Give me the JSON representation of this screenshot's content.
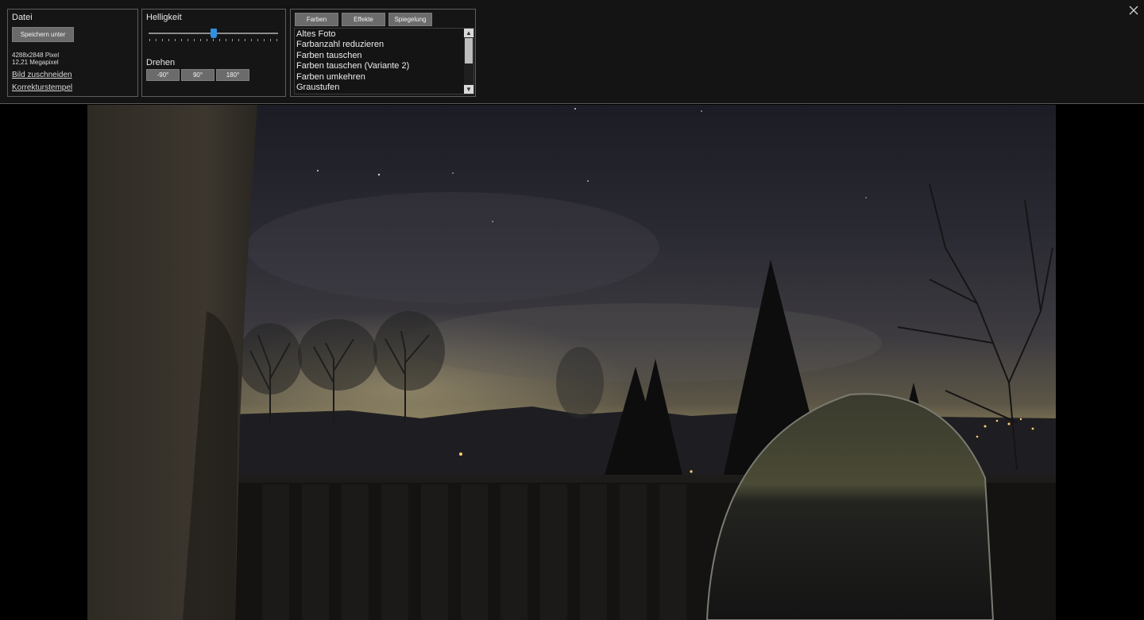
{
  "file_panel": {
    "title": "Datei",
    "save_as_label": "Speichern unter",
    "dimensions": "4288x2848 Pixel",
    "megapixel": "12,21 Megapixel",
    "crop_link": "Bild zuschneiden",
    "stamp_link": "Korrekturstempel"
  },
  "brightness_panel": {
    "title": "Helligkeit",
    "slider_value": 0.5,
    "rotate_title": "Drehen",
    "rotate_buttons": [
      "-90°",
      "90°",
      "180°"
    ]
  },
  "effects_panel": {
    "tabs": [
      "Farben",
      "Effekte",
      "Spiegelung"
    ],
    "items": [
      "Altes Foto",
      "Farbanzahl reduzieren",
      "Farben tauschen",
      "Farben tauschen (Variante 2)",
      "Farben umkehren",
      "Graustufen"
    ]
  },
  "icons": {
    "close": "close-icon",
    "scroll_up": "chevron-up-icon",
    "scroll_down": "chevron-down-icon"
  },
  "colors": {
    "background": "#000000",
    "toolbar": "#141414",
    "button": "#6b6b6b",
    "slider_accent": "#2f8fe0"
  }
}
